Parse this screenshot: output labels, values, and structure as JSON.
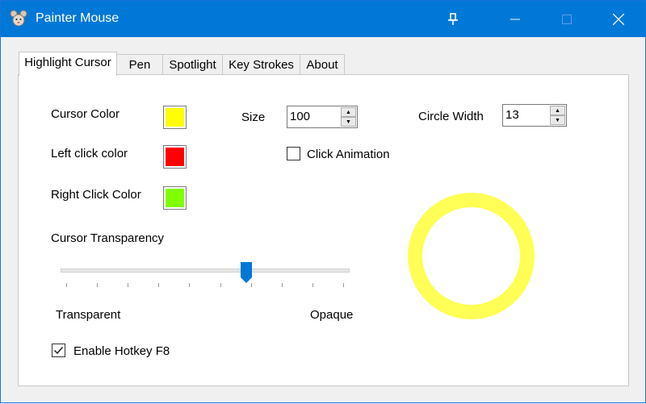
{
  "window": {
    "title": "Painter Mouse",
    "buttons": {
      "pin": "pin-icon",
      "minimize": "minimize-icon",
      "maximize": "maximize-icon",
      "close": "close-icon"
    }
  },
  "tabs": [
    {
      "label": "Highlight Cursor",
      "active": true
    },
    {
      "label": "Pen",
      "active": false
    },
    {
      "label": "Spotlight",
      "active": false
    },
    {
      "label": "Key Strokes",
      "active": false
    },
    {
      "label": "About",
      "active": false
    }
  ],
  "highlight": {
    "cursor_color_label": "Cursor Color",
    "cursor_color": "#ffff00",
    "left_click_label": "Left click color",
    "left_click_color": "#ff0000",
    "right_click_label": "Right Click Color",
    "right_click_color": "#80ff00",
    "size_label": "Size",
    "size_value": "100",
    "circle_width_label": "Circle Width",
    "circle_width_value": "13",
    "click_animation_label": "Click Animation",
    "click_animation_checked": false,
    "transparency_label": "Cursor Transparency",
    "transparency_value": 0.65,
    "transparent_label": "Transparent",
    "opaque_label": "Opaque",
    "hotkey_label": "Enable Hotkey F8",
    "hotkey_checked": true,
    "preview_color": "#ffff55"
  },
  "colors": {
    "titlebar": "#0078d7",
    "accent": "#0078d7"
  }
}
